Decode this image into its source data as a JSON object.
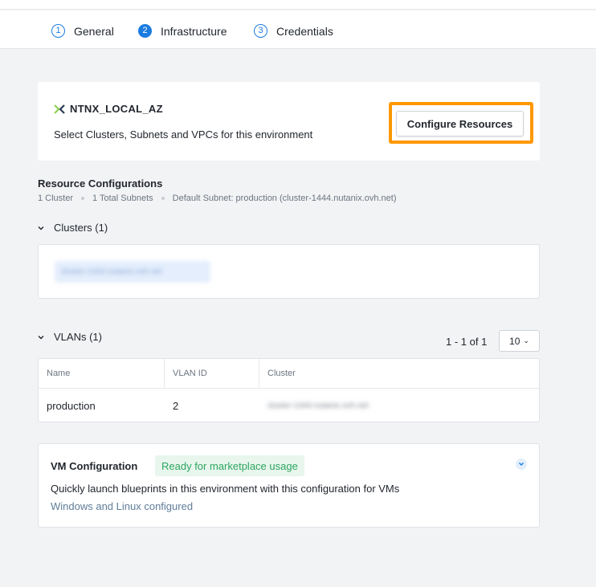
{
  "steps": [
    {
      "number": "1",
      "label": "General",
      "active": false
    },
    {
      "number": "2",
      "label": "Infrastructure",
      "active": true
    },
    {
      "number": "3",
      "label": "Credentials",
      "active": false
    }
  ],
  "account": {
    "name": "NTNX_LOCAL_AZ",
    "description": "Select Clusters, Subnets and VPCs for this environment",
    "configure_button": "Configure Resources",
    "highlight_color": "#ff9800",
    "logo_icon": "nutanix-x-icon"
  },
  "resource_configurations": {
    "title": "Resource Configurations",
    "meta": [
      "1 Cluster",
      "1 Total Subnets",
      "Default Subnet: production (cluster-1444.nutanix.ovh.net)"
    ]
  },
  "clusters": {
    "heading": "Clusters (1)",
    "items": [
      "cluster-1444.nutanix.ovh.net"
    ]
  },
  "vlans": {
    "heading": "VLANs (1)",
    "pagination": "1 - 1 of 1",
    "page_size": "10",
    "columns": [
      "Name",
      "VLAN ID",
      "Cluster"
    ],
    "rows": [
      {
        "name": "production",
        "vlan_id": "2",
        "cluster": "cluster-1444.nutanix.ovh.net"
      }
    ]
  },
  "vm_configuration": {
    "title": "VM Configuration",
    "badge": "Ready for marketplace usage",
    "description": "Quickly launch blueprints in this environment with this configuration for VMs",
    "subtext": "Windows and Linux configured"
  },
  "colors": {
    "accent": "#1b7ce0",
    "success": "#2ea65f",
    "nutanix_green": "#8fd14f"
  }
}
